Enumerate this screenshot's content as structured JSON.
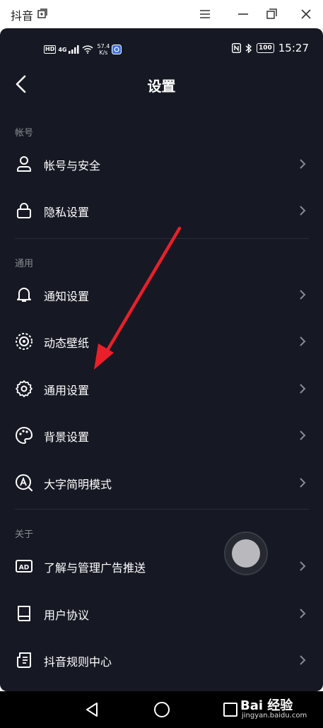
{
  "window": {
    "title": "抖音"
  },
  "status": {
    "speed_value": "57.4",
    "speed_unit": "K/s",
    "time": "15:27",
    "battery": "100",
    "network": "4G",
    "hd": "HD"
  },
  "header": {
    "title": "设置"
  },
  "sections": [
    {
      "title": "帐号",
      "items": [
        {
          "label": "帐号与安全",
          "icon": "user-icon"
        },
        {
          "label": "隐私设置",
          "icon": "lock-icon"
        }
      ]
    },
    {
      "title": "通用",
      "items": [
        {
          "label": "通知设置",
          "icon": "bell-icon"
        },
        {
          "label": "动态壁纸",
          "icon": "wallpaper-icon"
        },
        {
          "label": "通用设置",
          "icon": "gear-icon"
        },
        {
          "label": "背景设置",
          "icon": "palette-icon"
        },
        {
          "label": "大字简明模式",
          "icon": "large-font-icon"
        }
      ]
    },
    {
      "title": "关于",
      "items": [
        {
          "label": "了解与管理广告推送",
          "icon": "ad-icon"
        },
        {
          "label": "用户协议",
          "icon": "book-icon"
        },
        {
          "label": "抖音规则中心",
          "icon": "document-icon"
        }
      ]
    }
  ],
  "watermark": {
    "brand": "Bai 经验",
    "url": "jingyan.baidu.com"
  },
  "colors": {
    "background": "#161823",
    "text": "#ffffff",
    "section": "#8a8b91",
    "arrow": "#e8202a"
  }
}
